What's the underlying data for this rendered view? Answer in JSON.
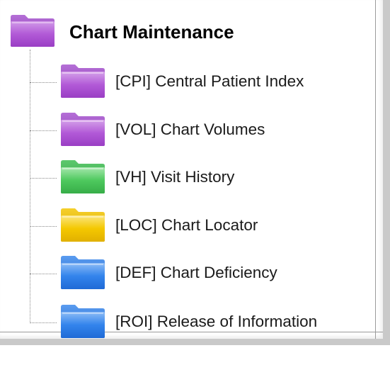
{
  "tree": {
    "root": {
      "label": "Chart Maintenance",
      "icon": "folder-icon",
      "color": "#a24fc7"
    },
    "items": [
      {
        "label": "[CPI] Central Patient Index",
        "icon": "folder-icon",
        "color": "#a24fc7"
      },
      {
        "label": "[VOL] Chart Volumes",
        "icon": "folder-icon",
        "color": "#a24fc7"
      },
      {
        "label": "[VH] Visit History",
        "icon": "folder-icon",
        "color": "#3fbf55"
      },
      {
        "label": "[LOC] Chart Locator",
        "icon": "folder-icon",
        "color": "#f2c200"
      },
      {
        "label": "[DEF] Chart Deficiency",
        "icon": "folder-icon",
        "color": "#2f7ee6"
      },
      {
        "label": "[ROI] Release of Information",
        "icon": "folder-icon",
        "color": "#2f7ee6"
      }
    ]
  }
}
